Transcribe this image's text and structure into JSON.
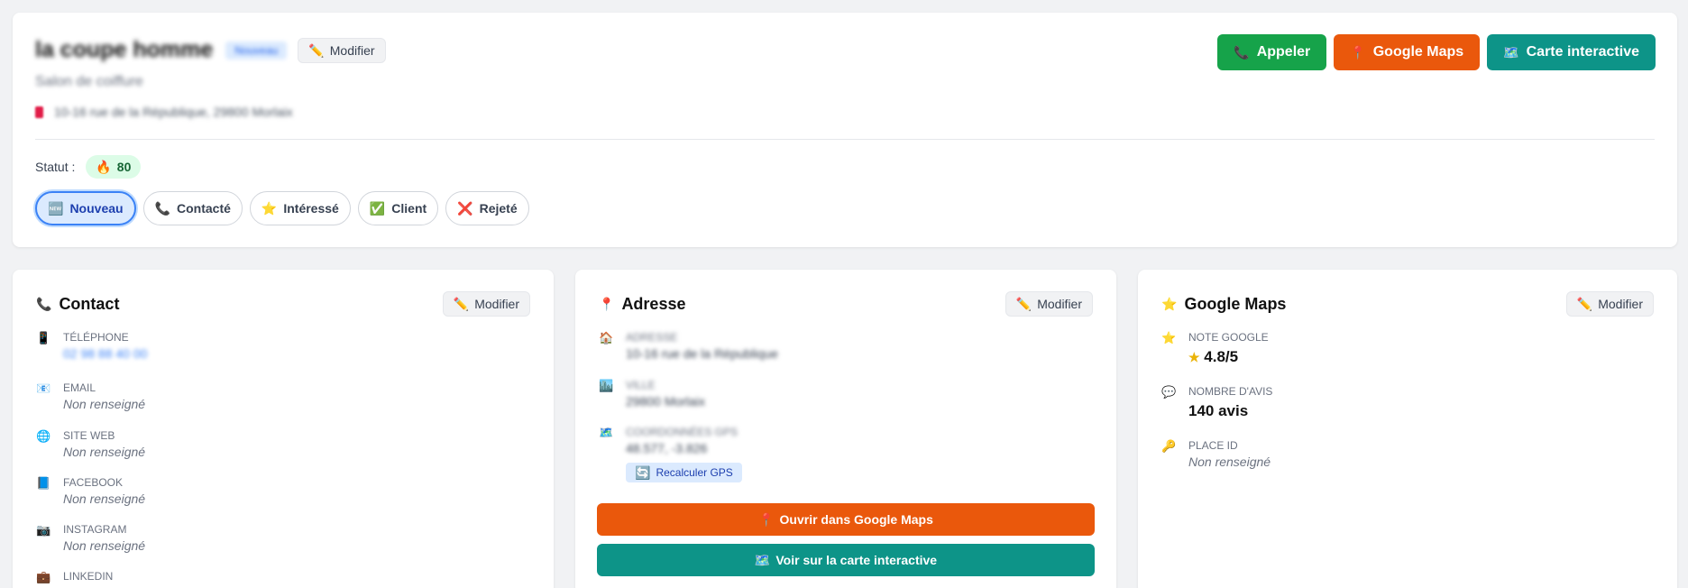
{
  "header": {
    "title": "la coupe homme",
    "badge": "Nouveau",
    "edit_label": "Modifier",
    "subtitle": "Salon de coiffure",
    "address": "10-16 rue de la République, 29800 Morlaix",
    "actions": {
      "call": "Appeler",
      "google_maps": "Google Maps",
      "interactive_map": "Carte interactive"
    },
    "status_label": "Statut :",
    "score": "80",
    "statuses": [
      "Nouveau",
      "Contacté",
      "Intéressé",
      "Client",
      "Rejeté"
    ]
  },
  "contact": {
    "title": "Contact",
    "edit_label": "Modifier",
    "fields": {
      "phone": {
        "label": "Téléphone",
        "value": "02 98 88 40 00"
      },
      "email": {
        "label": "Email",
        "value": "Non renseigné"
      },
      "website": {
        "label": "Site web",
        "value": "Non renseigné"
      },
      "facebook": {
        "label": "Facebook",
        "value": "Non renseigné"
      },
      "instagram": {
        "label": "Instagram",
        "value": "Non renseigné"
      },
      "linkedin": {
        "label": "LinkedIn"
      }
    }
  },
  "address": {
    "title": "Adresse",
    "edit_label": "Modifier",
    "street": {
      "label": "Adresse",
      "value": "10-16 rue de la République"
    },
    "city": {
      "label": "Ville",
      "value": "29800 Morlaix"
    },
    "coords": {
      "label": "Coordonnées GPS",
      "value": "48.577, -3.826"
    },
    "recalc_label": "Recalculer GPS",
    "open_gmaps": "Ouvrir dans Google Maps",
    "open_map": "Voir sur la carte interactive"
  },
  "gmaps": {
    "title": "Google Maps",
    "edit_label": "Modifier",
    "rating": {
      "label": "Note Google",
      "value": "4.8/5"
    },
    "reviews": {
      "label": "Nombre d'avis",
      "value": "140 avis"
    },
    "place_id": {
      "label": "Place ID",
      "value": "Non renseigné"
    }
  },
  "colors": {
    "call": "#16a34a",
    "google_maps": "#ea580c",
    "interactive_map": "#0d9488",
    "active_status": "#3b82f6",
    "score_bg": "#dcfce7"
  }
}
